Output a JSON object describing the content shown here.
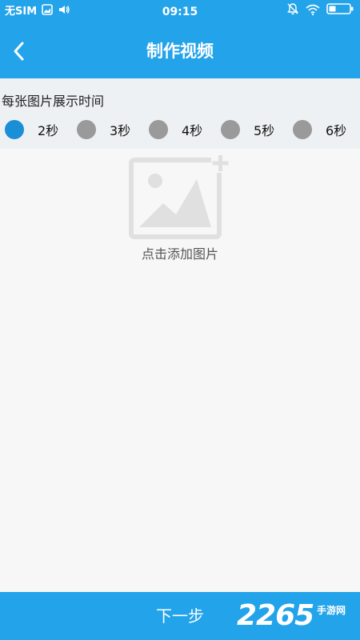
{
  "status_bar": {
    "carrier": "无SIM",
    "time": "09:15",
    "icons": [
      "image-notification-icon",
      "volume-icon",
      "bell-off-icon",
      "wifi-icon",
      "battery-icon"
    ]
  },
  "header": {
    "title": "制作视频",
    "back_icon": "chevron-left-icon"
  },
  "duration": {
    "label": "每张图片展示时间",
    "options": [
      {
        "label": "2秒",
        "selected": true
      },
      {
        "label": "3秒",
        "selected": false
      },
      {
        "label": "4秒",
        "selected": false
      },
      {
        "label": "5秒",
        "selected": false
      },
      {
        "label": "6秒",
        "selected": false
      }
    ]
  },
  "add_image": {
    "label": "点击添加图片",
    "icon": "add-image-icon"
  },
  "footer": {
    "next_label": "下一步",
    "watermark_number": "2265",
    "watermark_text": "手游网"
  },
  "colors": {
    "primary": "#23a3ea",
    "selected_radio": "#1a8ed6",
    "unselected_radio": "#9a9a9a",
    "background": "#f7f7f7",
    "section_background": "#eef1f3"
  }
}
